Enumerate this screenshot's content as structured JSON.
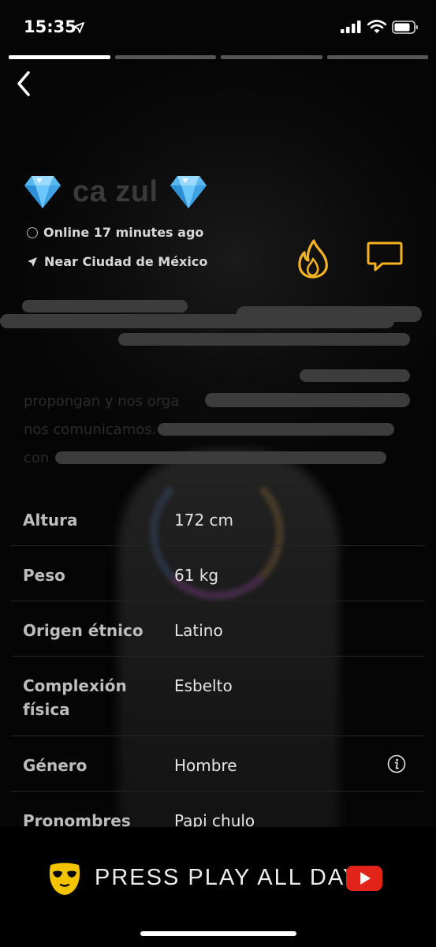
{
  "status_bar": {
    "time": "15:35",
    "icons": [
      "location-arrow-icon",
      "signal-icon",
      "wifi-icon",
      "battery-icon"
    ]
  },
  "story_progress": {
    "segments": 4,
    "active_index": 0
  },
  "header": {
    "back_icon": "chevron-left-icon",
    "name_visible": "ca      zul",
    "name_icon": "diamond-icon",
    "online_status": "Online 17 minutes ago",
    "location": "Near Ciudad de México"
  },
  "actions": {
    "tap_icon": "flame-icon",
    "chat_icon": "chat-bubble-icon",
    "accent_color": "#F4B322"
  },
  "bio": {
    "visible_fragments": [
      "propongan y nos orga",
      "nos comunicamos. Sí",
      "con"
    ],
    "redacted": true
  },
  "stats": [
    {
      "label": "Altura",
      "value": "172 cm"
    },
    {
      "label": "Peso",
      "value": "61 kg"
    },
    {
      "label": "Origen étnico",
      "value": "Latino"
    },
    {
      "label": "Complexión física",
      "value": "Esbelto"
    },
    {
      "label": "Género",
      "value": "Hombre",
      "icon": "info-icon"
    },
    {
      "label": "Pronombres",
      "value": "Papi chulo"
    }
  ],
  "ad_banner": {
    "text": "PRESS PLAY ALL DAY",
    "logo_icon": "grindr-mask-icon",
    "play_icon": "youtube-play-icon",
    "logo_color": "#F4C300",
    "play_color": "#E2231A"
  }
}
